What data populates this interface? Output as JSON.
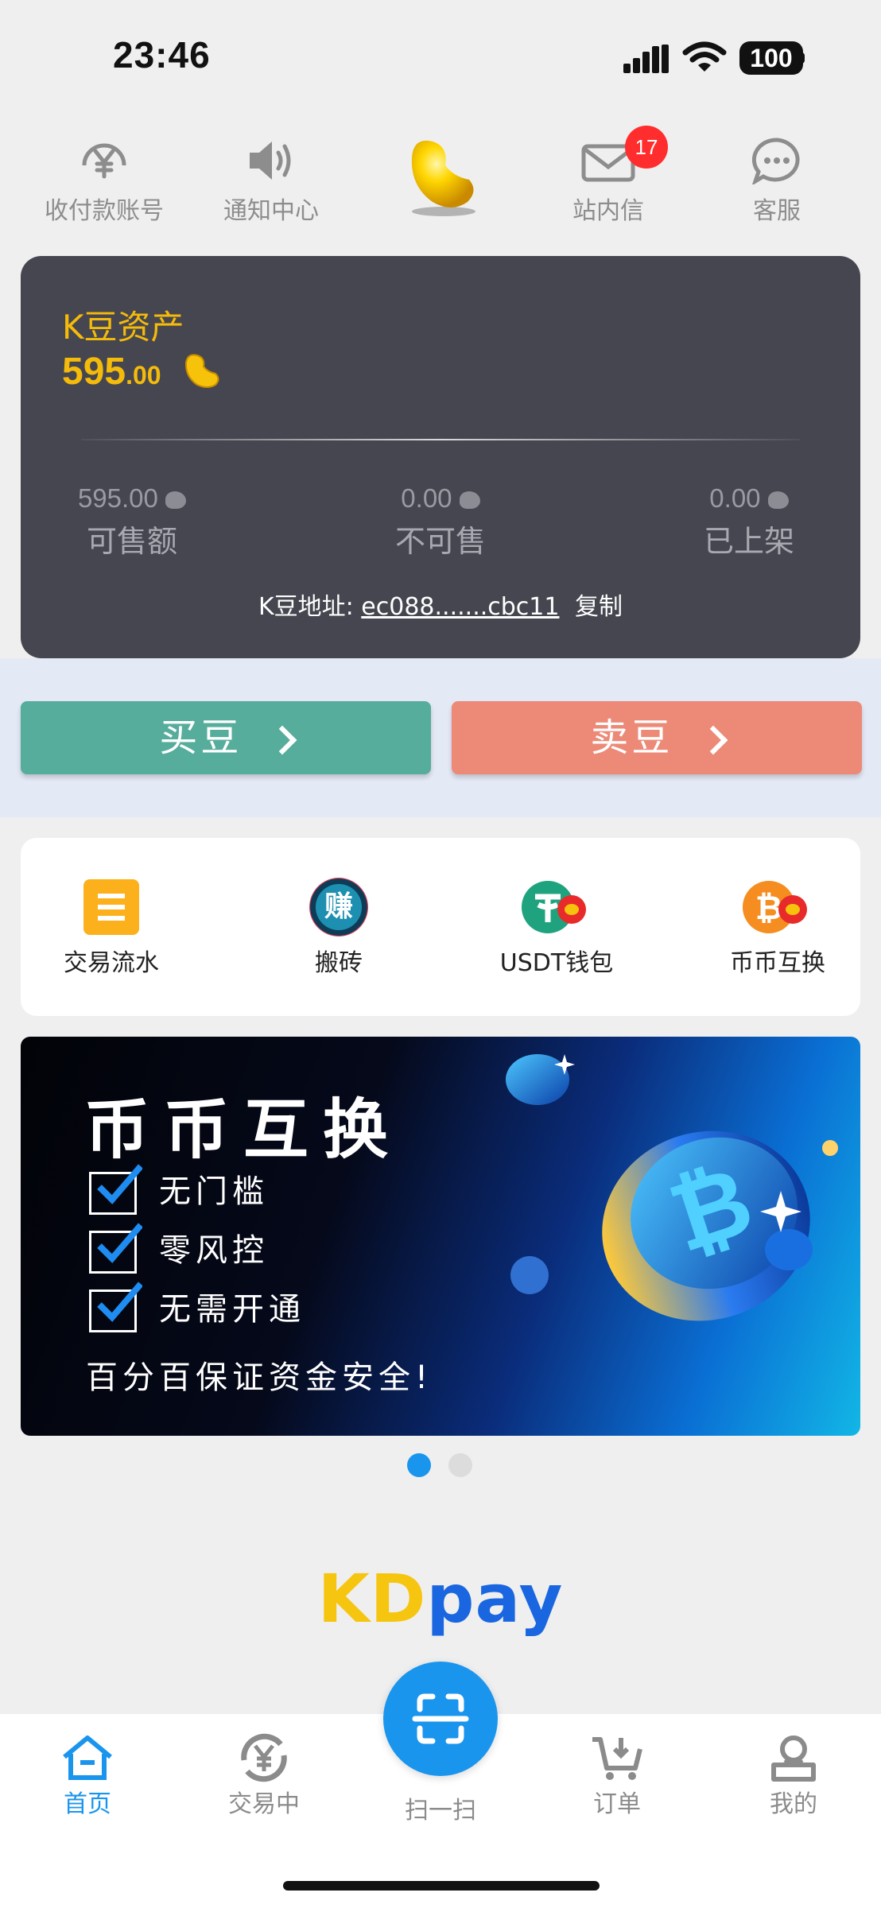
{
  "status_bar": {
    "time": "23:46",
    "battery": "100"
  },
  "top_nav": [
    {
      "label": "收付款账号",
      "icon": "yen-icon"
    },
    {
      "label": "通知中心",
      "icon": "speaker-icon"
    },
    {
      "label": "",
      "icon": "gold-bean-logo"
    },
    {
      "label": "站内信",
      "icon": "mail-icon",
      "badge": "17"
    },
    {
      "label": "客服",
      "icon": "chat-icon"
    }
  ],
  "asset_card": {
    "title": "K豆资产",
    "amount_int": "595",
    "amount_dec": ".00",
    "stats": [
      {
        "value": "595.00",
        "label": "可售额"
      },
      {
        "value": "0.00",
        "label": "不可售"
      },
      {
        "value": "0.00",
        "label": "已上架"
      }
    ],
    "address_label": "K豆地址:",
    "address_value": "ec088.......cbc11",
    "copy_label": "复制"
  },
  "actions": {
    "buy": "买豆",
    "sell": "卖豆"
  },
  "quick_menu": [
    {
      "label": "交易流水",
      "icon": "ledger-icon"
    },
    {
      "label": "搬砖",
      "icon": "earn-icon",
      "icon_text": "赚"
    },
    {
      "label": "USDT钱包",
      "icon": "tether-icon"
    },
    {
      "label": "币币互换",
      "icon": "bitcoin-icon"
    }
  ],
  "banner": {
    "title": "币币互换",
    "lines": [
      "无门槛",
      "零风控",
      "无需开通"
    ],
    "subtitle": "百分百保证资金安全!"
  },
  "carousel": {
    "current": 1,
    "total": 2
  },
  "brand": {
    "part1": "KD",
    "part2": "pay",
    "color1": "#f6c510",
    "color2": "#1a66e0"
  },
  "bottom_nav": [
    {
      "label": "首页",
      "icon": "home-icon",
      "active": true
    },
    {
      "label": "交易中",
      "icon": "exchange-icon"
    },
    {
      "label": "扫一扫",
      "icon": "scan-icon"
    },
    {
      "label": "订单",
      "icon": "cart-icon"
    },
    {
      "label": "我的",
      "icon": "profile-icon"
    }
  ],
  "colors": {
    "accent": "#1a95ee",
    "gold": "#f4bb0a",
    "buy": "#56ad9c",
    "sell": "#ec8a77",
    "card": "#464650"
  }
}
